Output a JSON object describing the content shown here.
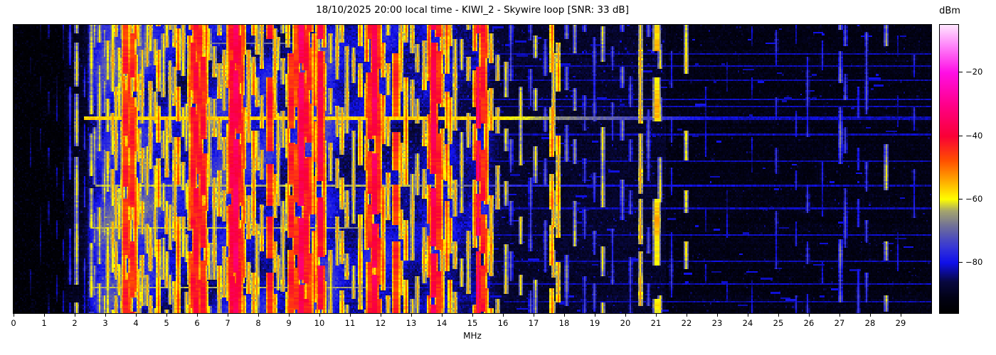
{
  "figure": {
    "title": "18/10/2025 20:00 local time - KIWI_2 - Skywire loop [SNR: 33 dB]",
    "background": "#ffffff"
  },
  "chart_data": {
    "type": "heatmap",
    "subtype": "radio-spectrum-waterfall",
    "title": "18/10/2025 20:00 local time - KIWI_2 - Skywire loop [SNR: 33 dB]",
    "xlabel": "MHz",
    "ylabel": "",
    "colorbar_label": "dBm",
    "freq_range": [
      0,
      30
    ],
    "value_range": [
      -96,
      -5
    ],
    "grid": false,
    "x_ticks": {
      "values": [
        0,
        1,
        2,
        3,
        4,
        5,
        6,
        7,
        8,
        9,
        10,
        11,
        12,
        13,
        14,
        15,
        16,
        17,
        18,
        19,
        20,
        21,
        22,
        23,
        24,
        25,
        26,
        27,
        28,
        29
      ],
      "labels": [
        "0",
        "1",
        "2",
        "3",
        "4",
        "5",
        "6",
        "7",
        "8",
        "9",
        "10",
        "11",
        "12",
        "13",
        "14",
        "15",
        "16",
        "17",
        "18",
        "19",
        "20",
        "21",
        "22",
        "23",
        "24",
        "25",
        "26",
        "27",
        "28",
        "29"
      ]
    },
    "colorbar_ticks": [
      {
        "value": -20,
        "label": "−20"
      },
      {
        "value": -40,
        "label": "−40"
      },
      {
        "value": -60,
        "label": "−60"
      },
      {
        "value": -80,
        "label": "−80"
      }
    ],
    "colormap_stops": [
      [
        0.0,
        0,
        0,
        0
      ],
      [
        0.055,
        2,
        2,
        22
      ],
      [
        0.11,
        8,
        8,
        64
      ],
      [
        0.176,
        16,
        16,
        235
      ],
      [
        0.23,
        55,
        55,
        215
      ],
      [
        0.3,
        110,
        110,
        155
      ],
      [
        0.355,
        165,
        165,
        110
      ],
      [
        0.396,
        255,
        255,
        0
      ],
      [
        0.46,
        255,
        170,
        0
      ],
      [
        0.53,
        255,
        80,
        0
      ],
      [
        0.615,
        250,
        0,
        55
      ],
      [
        0.72,
        255,
        0,
        135
      ],
      [
        0.835,
        255,
        15,
        230
      ],
      [
        0.93,
        255,
        135,
        250
      ],
      [
        1.0,
        255,
        230,
        255
      ]
    ],
    "grid_bins": {
      "freq": 560,
      "time": 164
    },
    "noise_floor_segments": [
      {
        "f_max": 1.65,
        "level": -95.5
      },
      {
        "f_max": 2.4,
        "level": -90.5
      },
      {
        "f_max": 15.6,
        "level": -87.0
      },
      {
        "f_max": 21.3,
        "level": -88.5
      },
      {
        "f_max": 30.0,
        "level": -91.5
      }
    ],
    "noise_humps": [
      [
        2.7,
        0.25,
        5
      ],
      [
        3.1,
        0.3,
        8
      ],
      [
        3.8,
        0.55,
        15
      ],
      [
        4.6,
        0.4,
        7
      ],
      [
        5.3,
        0.3,
        6
      ],
      [
        6.05,
        0.3,
        10
      ],
      [
        6.7,
        0.3,
        7
      ],
      [
        7.25,
        0.35,
        13
      ],
      [
        8.0,
        0.3,
        7
      ],
      [
        8.4,
        0.2,
        7
      ],
      [
        9.6,
        0.5,
        12
      ],
      [
        10.2,
        0.25,
        6
      ],
      [
        10.7,
        0.4,
        5
      ],
      [
        11.8,
        0.4,
        10
      ],
      [
        12.7,
        0.4,
        5
      ],
      [
        13.75,
        0.35,
        9
      ],
      [
        14.3,
        0.3,
        5
      ],
      [
        15.3,
        0.35,
        8
      ]
    ],
    "carriers": [
      [
        0.55,
        -87,
        0,
        0.25
      ],
      [
        0.85,
        -86,
        0,
        0.25
      ],
      [
        1.15,
        -86,
        0,
        0.3
      ],
      [
        1.4,
        -85,
        0,
        0.3
      ],
      [
        1.6,
        -84,
        0,
        0.35
      ],
      [
        1.81,
        -79,
        0,
        0.8
      ],
      [
        2.02,
        -61,
        0,
        0.95
      ],
      [
        2.3,
        -79,
        0,
        0.5
      ],
      [
        2.51,
        -62,
        0,
        0.85
      ],
      [
        2.65,
        -65,
        0,
        0.6
      ],
      [
        2.8,
        -60,
        0,
        0.75
      ],
      [
        2.92,
        -64,
        0,
        0.55
      ],
      [
        3.06,
        -59,
        0,
        0.7
      ],
      [
        3.2,
        -57,
        0,
        0.8
      ],
      [
        3.33,
        -55,
        0,
        0.85
      ],
      [
        3.42,
        -59,
        0,
        0.65
      ],
      [
        3.52,
        -54,
        0,
        0.75
      ],
      [
        3.6,
        -49,
        0,
        0.85
      ],
      [
        3.65,
        -44,
        1,
        0.9
      ],
      [
        3.75,
        -46,
        0,
        0.85
      ],
      [
        3.8,
        -51,
        0,
        0.7
      ],
      [
        3.85,
        -44,
        1,
        0.85
      ],
      [
        3.95,
        -47,
        0,
        0.8
      ],
      [
        4.05,
        -54,
        0,
        0.7
      ],
      [
        4.2,
        -55,
        0,
        0.7
      ],
      [
        4.32,
        -57,
        0,
        0.6
      ],
      [
        4.47,
        -56,
        0,
        0.65
      ],
      [
        4.6,
        -58,
        0,
        0.55
      ],
      [
        4.72,
        -50,
        0,
        0.8
      ],
      [
        4.85,
        -59,
        0,
        0.55
      ],
      [
        5.0,
        -56,
        0,
        0.7
      ],
      [
        5.1,
        -57,
        0,
        0.65
      ],
      [
        5.25,
        -54,
        0,
        0.7
      ],
      [
        5.35,
        -48,
        0,
        0.8
      ],
      [
        5.5,
        -57,
        0,
        0.55
      ],
      [
        5.62,
        -59,
        0,
        0.5
      ],
      [
        5.75,
        -51,
        0,
        0.7
      ],
      [
        5.85,
        -44,
        1,
        0.9
      ],
      [
        5.95,
        -42,
        1,
        0.9
      ],
      [
        6.05,
        -45,
        1,
        0.85
      ],
      [
        6.15,
        -43,
        1,
        0.9
      ],
      [
        6.25,
        -48,
        0,
        0.8
      ],
      [
        6.4,
        -57,
        0,
        0.55
      ],
      [
        6.55,
        -55,
        0,
        0.65
      ],
      [
        6.7,
        -52,
        0,
        0.7
      ],
      [
        6.88,
        -54,
        0,
        0.65
      ],
      [
        7.05,
        -45,
        1,
        0.9
      ],
      [
        7.15,
        -40,
        1,
        0.95
      ],
      [
        7.22,
        -36,
        1,
        0.97
      ],
      [
        7.33,
        -42,
        1,
        0.9
      ],
      [
        7.42,
        -46,
        0,
        0.85
      ],
      [
        7.52,
        -48,
        0,
        0.8
      ],
      [
        7.65,
        -54,
        0,
        0.65
      ],
      [
        7.8,
        -51,
        0,
        0.7
      ],
      [
        7.95,
        -55,
        0,
        0.6
      ],
      [
        8.1,
        -53,
        0,
        0.65
      ],
      [
        8.35,
        -42,
        1,
        0.9
      ],
      [
        8.5,
        -54,
        0,
        0.65
      ],
      [
        8.65,
        -57,
        0,
        0.55
      ],
      [
        8.8,
        -56,
        0,
        0.55
      ],
      [
        8.95,
        -51,
        0,
        0.65
      ],
      [
        9.05,
        -44,
        1,
        0.9
      ],
      [
        9.2,
        -46,
        1,
        0.85
      ],
      [
        9.4,
        -36,
        1,
        0.97
      ],
      [
        9.55,
        -42,
        1,
        0.9
      ],
      [
        9.65,
        -45,
        1,
        0.85
      ],
      [
        9.8,
        -46,
        0,
        0.85
      ],
      [
        9.9,
        -51,
        0,
        0.75
      ],
      [
        10.0,
        -39,
        1,
        0.95
      ],
      [
        10.15,
        -49,
        0,
        0.8
      ],
      [
        10.35,
        -57,
        0,
        0.55
      ],
      [
        10.55,
        -55,
        0,
        0.6
      ],
      [
        10.7,
        -53,
        0,
        0.65
      ],
      [
        10.9,
        -56,
        0,
        0.55
      ],
      [
        11.1,
        -57,
        0,
        0.55
      ],
      [
        11.3,
        -51,
        0,
        0.7
      ],
      [
        11.5,
        -49,
        0,
        0.75
      ],
      [
        11.65,
        -44,
        1,
        0.9
      ],
      [
        11.76,
        -37,
        1,
        0.95
      ],
      [
        11.9,
        -45,
        1,
        0.85
      ],
      [
        12.05,
        -49,
        0,
        0.75
      ],
      [
        12.2,
        -55,
        0,
        0.6
      ],
      [
        12.5,
        -45,
        1,
        0.85
      ],
      [
        12.65,
        -53,
        0,
        0.65
      ],
      [
        12.8,
        -49,
        0,
        0.7
      ],
      [
        13.0,
        -56,
        0,
        0.55
      ],
      [
        13.2,
        -57,
        0,
        0.5
      ],
      [
        13.4,
        -54,
        0,
        0.6
      ],
      [
        13.58,
        -45,
        0,
        0.85
      ],
      [
        13.7,
        -38,
        1,
        0.95
      ],
      [
        13.85,
        -44,
        1,
        0.85
      ],
      [
        14.0,
        -51,
        0,
        0.7
      ],
      [
        14.12,
        -47,
        0,
        0.8
      ],
      [
        14.25,
        -50,
        0,
        0.7
      ],
      [
        14.4,
        -55,
        0,
        0.55
      ],
      [
        14.6,
        -59,
        0,
        0.45
      ],
      [
        14.85,
        -57,
        0,
        0.45
      ],
      [
        15.05,
        -49,
        0,
        0.8
      ],
      [
        15.15,
        -32,
        0,
        0.88
      ],
      [
        15.3,
        -43,
        1,
        0.85
      ],
      [
        15.45,
        -47,
        0,
        0.8
      ],
      [
        15.6,
        -53,
        0,
        0.6
      ],
      [
        15.78,
        -55,
        0,
        0.5
      ],
      [
        16.05,
        -59,
        0,
        0.4
      ],
      [
        16.25,
        -71,
        0,
        0.5
      ],
      [
        16.55,
        -61,
        0,
        0.4
      ],
      [
        16.85,
        -73,
        0,
        0.5
      ],
      [
        17.05,
        -62,
        0,
        0.4
      ],
      [
        17.35,
        -74,
        0,
        0.45
      ],
      [
        17.55,
        -49,
        0,
        0.8
      ],
      [
        17.65,
        -55,
        0,
        0.6
      ],
      [
        17.8,
        -51,
        0,
        0.75
      ],
      [
        18.05,
        -69,
        0,
        0.4
      ],
      [
        18.3,
        -63,
        0,
        0.4
      ],
      [
        18.65,
        -73,
        0,
        0.5
      ],
      [
        18.95,
        -75,
        0,
        0.45
      ],
      [
        19.25,
        -61,
        0,
        0.5
      ],
      [
        19.55,
        -75,
        0,
        0.45
      ],
      [
        19.85,
        -69,
        0,
        0.35
      ],
      [
        20.15,
        -74,
        0,
        0.4
      ],
      [
        20.45,
        -55,
        0,
        0.97
      ],
      [
        20.72,
        -73,
        0,
        0.4
      ],
      [
        20.98,
        -57,
        1,
        0.55
      ],
      [
        21.12,
        -61,
        0,
        0.45
      ],
      [
        21.5,
        -77,
        0,
        0.5
      ],
      [
        21.98,
        -59,
        0,
        0.45
      ],
      [
        22.6,
        -82,
        0,
        0.35
      ],
      [
        23.3,
        -83,
        0,
        0.3
      ],
      [
        24.1,
        -82,
        0,
        0.3
      ],
      [
        24.9,
        -78,
        0,
        0.45
      ],
      [
        25.55,
        -80,
        0,
        0.35
      ],
      [
        25.95,
        -76,
        0,
        0.45
      ],
      [
        26.4,
        -80,
        0,
        0.35
      ],
      [
        26.98,
        -69,
        0,
        0.65
      ],
      [
        27.15,
        -73,
        0,
        0.5
      ],
      [
        27.6,
        -77,
        0,
        0.45
      ],
      [
        27.88,
        -73,
        0,
        0.45
      ],
      [
        28.5,
        -63,
        0,
        0.25
      ],
      [
        28.9,
        -82,
        0,
        0.3
      ],
      [
        29.4,
        -78,
        0,
        0.4
      ]
    ],
    "events": [
      {
        "row": 0.317,
        "rows": 2,
        "profile": [
          [
            2.3,
            -57
          ],
          [
            15.5,
            -57
          ],
          [
            18.5,
            -68
          ],
          [
            21.4,
            -76
          ],
          [
            23,
            -81
          ],
          [
            30,
            -82
          ]
        ]
      },
      {
        "row": 0.556,
        "rows": 1,
        "profile": [
          [
            2.7,
            -63
          ],
          [
            13,
            -64
          ],
          [
            16,
            -76
          ],
          [
            19.8,
            -80
          ],
          [
            30,
            -83
          ]
        ]
      },
      {
        "row": 0.702,
        "rows": 1,
        "profile": [
          [
            2.5,
            -62
          ],
          [
            10.5,
            -63
          ],
          [
            12.5,
            -78
          ],
          [
            14,
            -83
          ]
        ]
      },
      {
        "row": 0.906,
        "rows": 1,
        "profile": [
          [
            2.5,
            -63
          ],
          [
            11,
            -64
          ],
          [
            13,
            -80
          ],
          [
            14,
            -83
          ]
        ]
      },
      {
        "row": 0.06,
        "rows": 1,
        "profile": [
          [
            5.5,
            -68
          ],
          [
            10,
            -69
          ],
          [
            10.8,
            -80
          ]
        ]
      }
    ],
    "side_streaks": [
      [
        0.099,
        14.5,
        -82
      ],
      [
        0.14,
        15.5,
        -82
      ],
      [
        0.19,
        13.8,
        -82.5
      ],
      [
        0.254,
        14.2,
        -81.5
      ],
      [
        0.278,
        15.8,
        -82
      ],
      [
        0.381,
        14.8,
        -82
      ],
      [
        0.468,
        13.6,
        -82
      ],
      [
        0.633,
        15.2,
        -82
      ],
      [
        0.727,
        14.0,
        -81.5
      ],
      [
        0.82,
        15.5,
        -82
      ],
      [
        0.894,
        13.8,
        -81.5
      ],
      [
        0.955,
        16.0,
        -82.5
      ]
    ],
    "random_dashes": {
      "count": 170,
      "f_min": 13.2,
      "f_max": 29.8,
      "power": -79,
      "power_spread": 4
    }
  }
}
